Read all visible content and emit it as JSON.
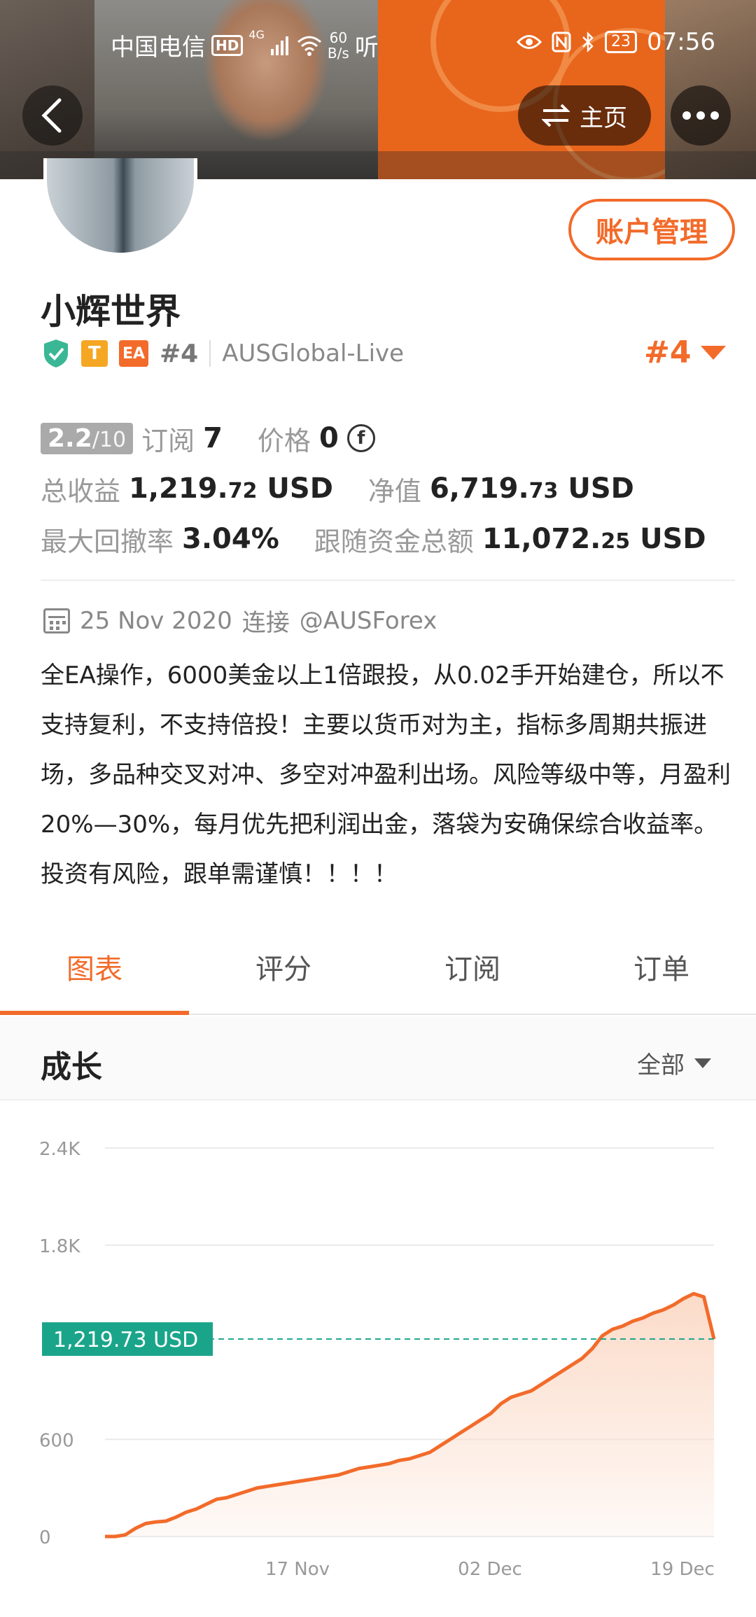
{
  "status_bar": {
    "carrier": "中国电信",
    "hd": "HD",
    "net": "4G",
    "speed_value": "60",
    "speed_unit": "B/s",
    "listen": "听",
    "battery": "23",
    "time": "07:56"
  },
  "nav": {
    "home_label": "主页"
  },
  "profile": {
    "name": "小辉世界",
    "account_button": "账户管理",
    "badge_t": "T",
    "badge_ea": "EA",
    "rank": "#4",
    "broker": "AUSGlobal-Live",
    "rank_highlight": "#4"
  },
  "stats": {
    "score_main": "2.2",
    "score_total": "/10",
    "subscribe_label": "订阅",
    "subscribe_value": "7",
    "price_label": "价格",
    "price_value": "0",
    "total_profit_label": "总收益",
    "total_profit_int": "1,219.",
    "total_profit_dec": "72",
    "total_profit_unit": "USD",
    "equity_label": "净值",
    "equity_int": "6,719.",
    "equity_dec": "73",
    "equity_unit": "USD",
    "drawdown_label": "最大回撤率",
    "drawdown_value": "3.04%",
    "follow_label": "跟随资金总额",
    "follow_int": "11,072.",
    "follow_dec": "25",
    "follow_unit": "USD"
  },
  "connect": {
    "date": "25 Nov 2020",
    "text": "连接",
    "handle": "@AUSForex"
  },
  "description": "全EA操作，6000美金以上1倍跟投，从0.02手开始建仓，所以不支持复利，不支持倍投！主要以货币对为主，指标多周期共振进场，多品种交叉对冲、多空对冲盈利出场。风险等级中等，月盈利20%—30%，每月优先把利润出金，落袋为安确保综合收益率。投资有风险，跟单需谨慎！！！！",
  "tabs": [
    {
      "label": "图表",
      "active": true
    },
    {
      "label": "评分",
      "active": false
    },
    {
      "label": "订阅",
      "active": false
    },
    {
      "label": "订单",
      "active": false
    }
  ],
  "growth": {
    "title": "成长",
    "filter": "全部"
  },
  "chart_data": {
    "type": "area",
    "yticks": [
      "0",
      "600",
      "1.8K",
      "2.4K"
    ],
    "ylim": [
      0,
      2400
    ],
    "xticks": [
      "17 Nov",
      "02 Dec",
      "19 Dec"
    ],
    "current_label": "1,219.73 USD",
    "current_value": 1219.73,
    "line_color": "#f26b2a",
    "fill_color": "#fbd9c6",
    "reference_color": "#1aa58a",
    "values": [
      0,
      0,
      10,
      50,
      80,
      90,
      95,
      120,
      150,
      170,
      200,
      230,
      240,
      260,
      280,
      300,
      310,
      320,
      330,
      340,
      350,
      360,
      370,
      380,
      400,
      420,
      430,
      440,
      450,
      470,
      480,
      500,
      520,
      560,
      600,
      640,
      680,
      720,
      760,
      820,
      860,
      880,
      900,
      940,
      980,
      1020,
      1060,
      1100,
      1160,
      1240,
      1280,
      1300,
      1330,
      1350,
      1380,
      1400,
      1430,
      1470,
      1500,
      1480,
      1220
    ]
  }
}
